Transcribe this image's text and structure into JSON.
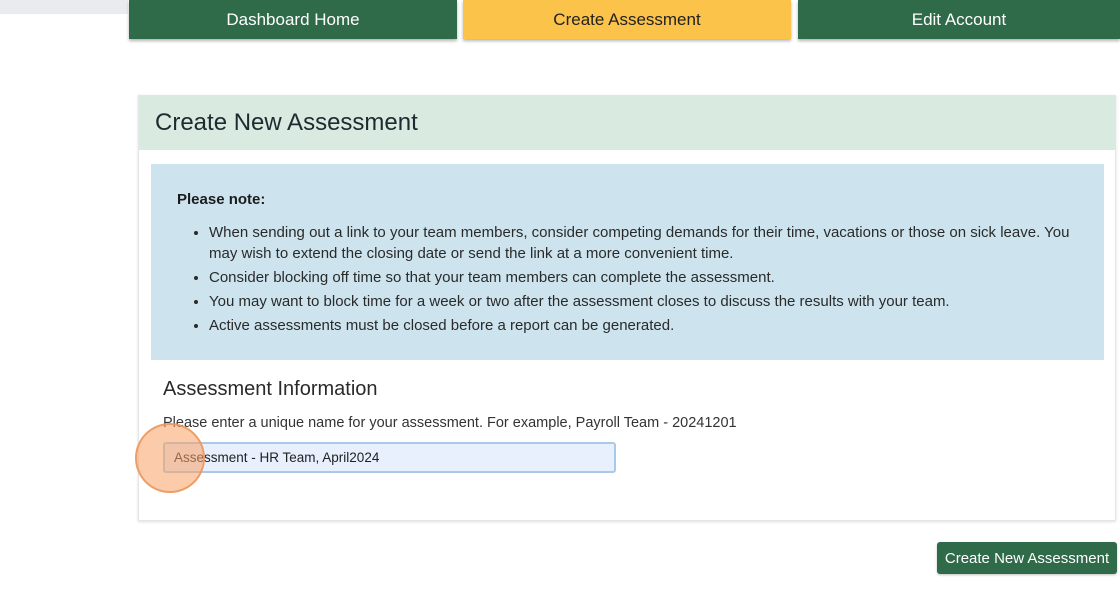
{
  "nav": {
    "tabs": [
      {
        "label": "Dashboard Home",
        "active": false
      },
      {
        "label": "Create Assessment",
        "active": true
      },
      {
        "label": "Edit Account",
        "active": false
      }
    ]
  },
  "card": {
    "title": "Create New Assessment",
    "note": {
      "heading": "Please note:",
      "items": [
        "When sending out a link to your team members, consider competing demands for their time, vacations or those on sick leave. You may wish to extend the closing date or send the link at a more convenient time.",
        "Consider blocking off time so that your team members can complete the assessment.",
        "You may want to block time for a week or two after the assessment closes to discuss the results with your team.",
        "Active assessments must be closed before a report can be generated."
      ]
    },
    "section_title": "Assessment Information",
    "instruction": "Please enter a unique name for your assessment. For example, Payroll Team - 20241201",
    "name_input_value": "Assessment - HR Team, April2024"
  },
  "submit_label": "Create New Assessment",
  "colors": {
    "brand_green": "#2f6a49",
    "active_tab_yellow": "#fcc34b",
    "header_band": "#d9eae0",
    "note_background": "#cde4ee",
    "input_fill": "#e8f0fe"
  }
}
